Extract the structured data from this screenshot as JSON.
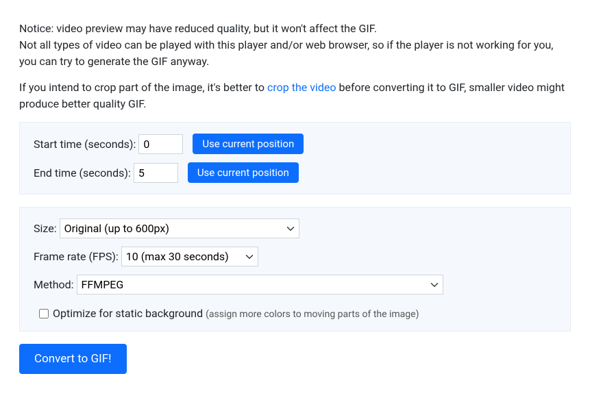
{
  "notice": {
    "line1": "Notice: video preview may have reduced quality, but it won't affect the GIF.",
    "line2": "Not all types of video can be played with this player and/or web browser, so if the player is not working for you, you can try to generate the GIF anyway.",
    "crop_pre": "If you intend to crop part of the image, it's better to ",
    "crop_link": "crop the video",
    "crop_post": " before converting it to GIF, smaller video might produce better quality GIF."
  },
  "time_panel": {
    "start_label": "Start time (seconds): ",
    "start_value": "0",
    "start_btn": "Use current position",
    "end_label": "End time (seconds): ",
    "end_value": "5",
    "end_btn": "Use current position"
  },
  "options_panel": {
    "size_label": "Size: ",
    "size_value": "Original (up to 600px)",
    "fps_label": "Frame rate (FPS): ",
    "fps_value": "10 (max 30 seconds)",
    "method_label": "Method: ",
    "method_value": "FFMPEG",
    "optimize_label": "Optimize for static background ",
    "optimize_hint": "(assign more colors to moving parts of the image)"
  },
  "convert_btn": "Convert to GIF!"
}
